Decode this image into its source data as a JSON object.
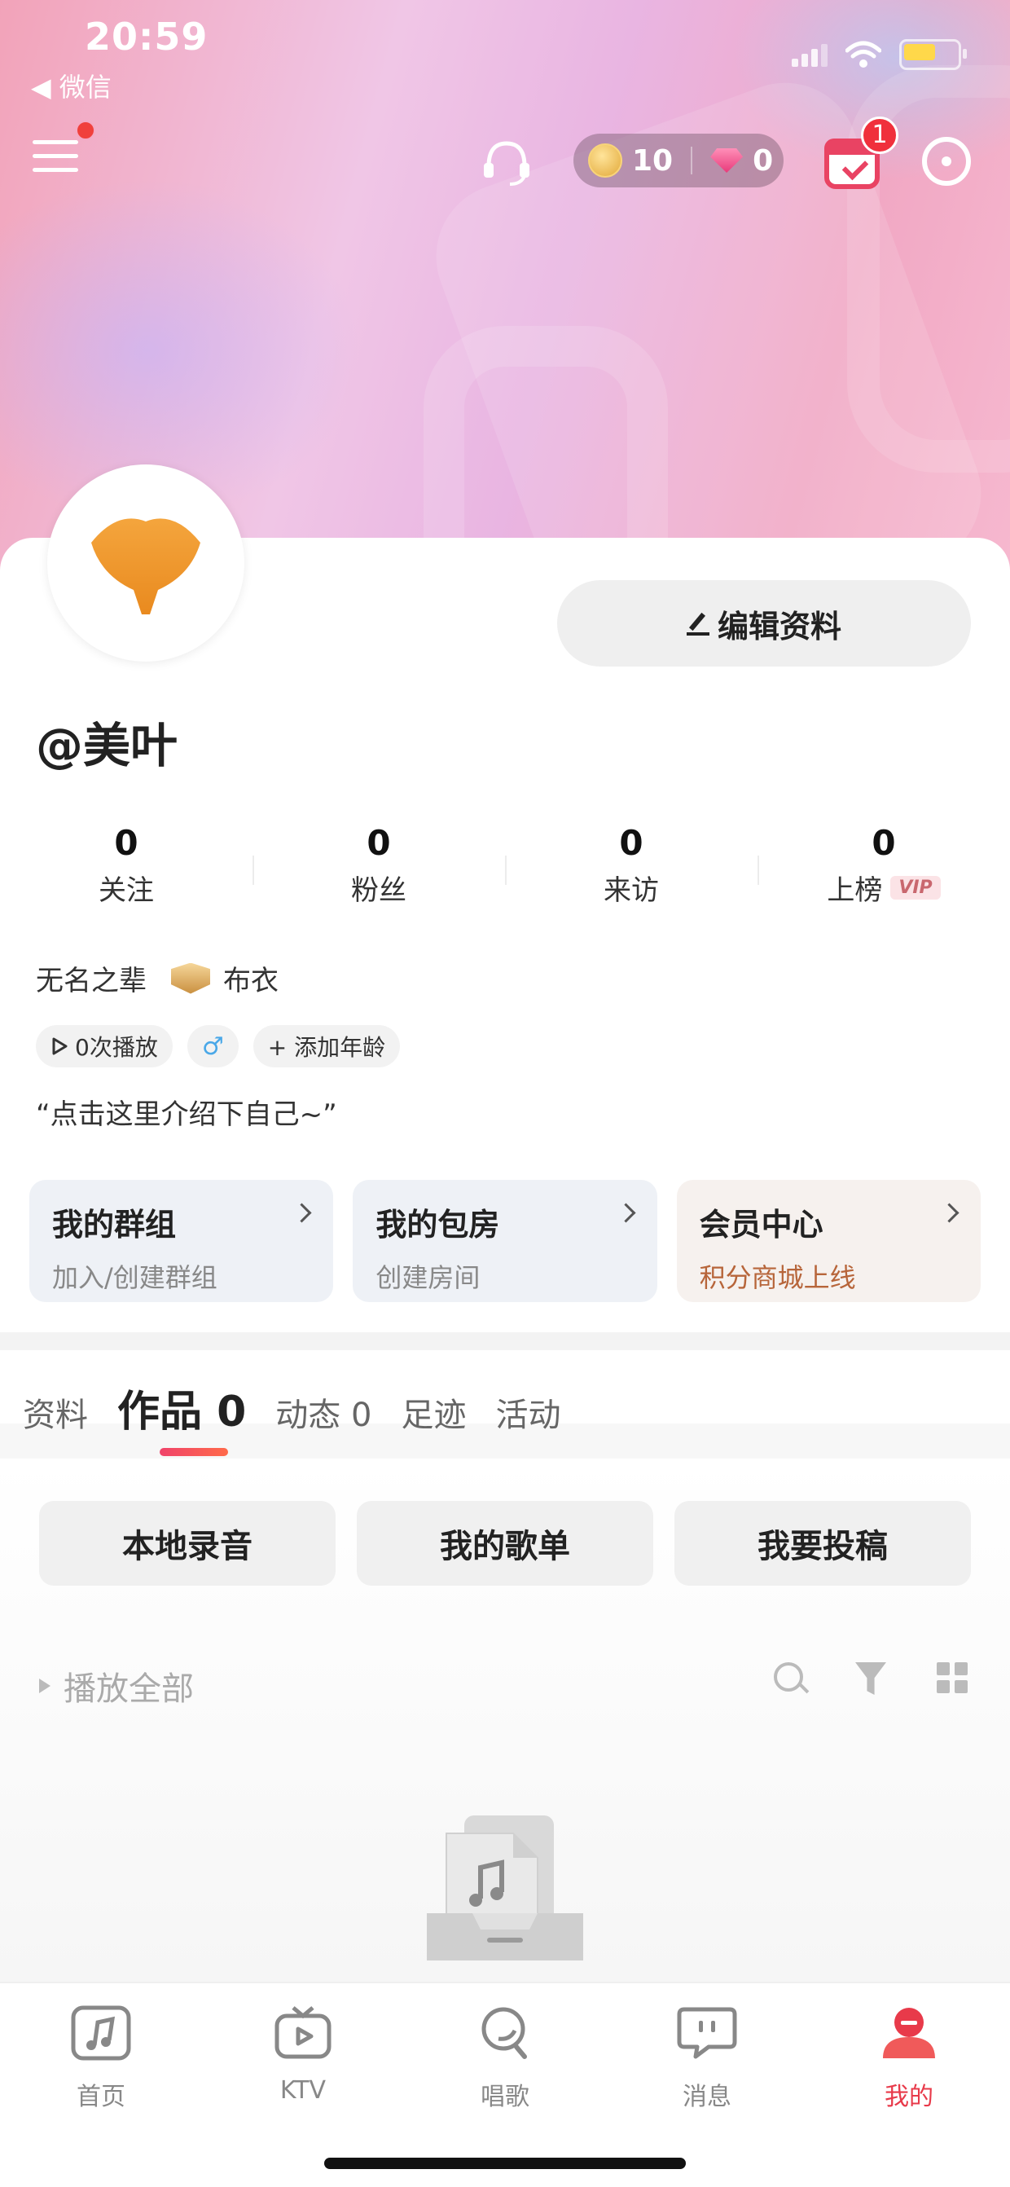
{
  "status_bar": {
    "time": "20:59",
    "back_label": "◀ 微信"
  },
  "header": {
    "coins": "10",
    "diamonds": "0",
    "calendar_badge": "1"
  },
  "profile": {
    "username": "@美叶",
    "edit_label": "编辑资料",
    "stats": [
      {
        "value": "0",
        "label": "关注"
      },
      {
        "value": "0",
        "label": "粉丝"
      },
      {
        "value": "0",
        "label": "来访"
      },
      {
        "value": "0",
        "label": "上榜",
        "badge": "VIP"
      }
    ],
    "title": "无名之辈",
    "rank": "布衣",
    "tags": {
      "plays": "0次播放",
      "gender": "♂",
      "add_age": "+ 添加年龄"
    },
    "intro": "“点击这里介绍下自己~”"
  },
  "shortcuts": [
    {
      "title": "我的群组",
      "subtitle": "加入/创建群组"
    },
    {
      "title": "我的包房",
      "subtitle": "创建房间"
    },
    {
      "title": "会员中心",
      "subtitle": "积分商城上线"
    }
  ],
  "tabs": [
    {
      "label": "资料"
    },
    {
      "label": "作品 0"
    },
    {
      "label": "动态 0"
    },
    {
      "label": "足迹"
    },
    {
      "label": "活动"
    }
  ],
  "works_actions": [
    "本地录音",
    "我的歌单",
    "我要投稿"
  ],
  "play_all_label": "播放全部",
  "bottom_nav": [
    {
      "label": "首页",
      "icon": "music-note-icon"
    },
    {
      "label": "KTV",
      "icon": "tv-play-icon"
    },
    {
      "label": "唱歌",
      "icon": "mic-icon"
    },
    {
      "label": "消息",
      "icon": "chat-icon"
    },
    {
      "label": "我的",
      "icon": "person-icon",
      "active": true
    }
  ],
  "colors": {
    "accent": "#e83a4a",
    "vip_subtitle": "#b7653a"
  }
}
